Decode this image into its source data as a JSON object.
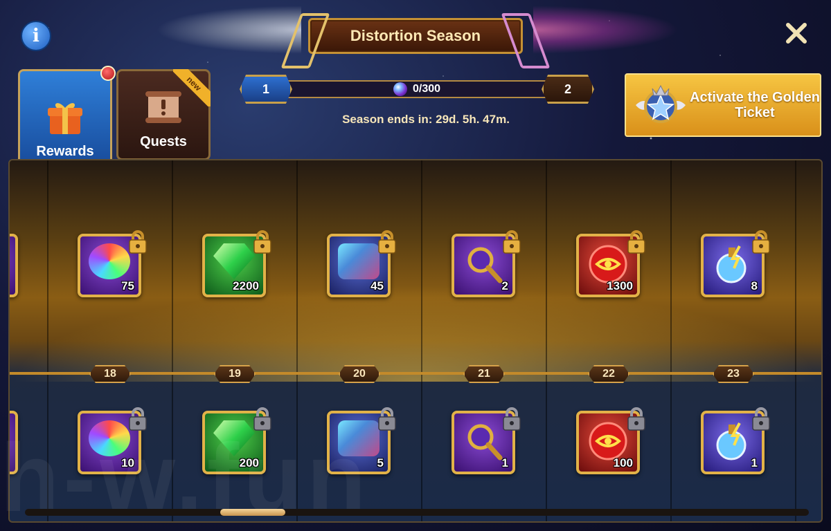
{
  "header": {
    "title": "Distortion Season",
    "info_icon": "info-icon",
    "close_icon": "close-icon"
  },
  "tabs": [
    {
      "label": "Rewards",
      "icon": "gift-icon",
      "active": true,
      "has_notification": true
    },
    {
      "label": "Quests",
      "icon": "scroll-icon",
      "active": false,
      "ribbon": "new"
    }
  ],
  "progress": {
    "current_level": "1",
    "next_level": "2",
    "points": "0/300",
    "fraction": 0.0,
    "season_ends": "Season ends in: 29d. 5h. 47m."
  },
  "golden_ticket": {
    "label": "Activate the Golden Ticket",
    "icon": "golden-ticket-emblem-icon"
  },
  "track": {
    "levels": [
      {
        "level": "18",
        "golden": {
          "icon": "rainbow-orb-icon",
          "qty": "75",
          "locked": true
        },
        "free": {
          "icon": "rainbow-orb-icon",
          "qty": "10",
          "locked": true
        }
      },
      {
        "level": "19",
        "golden": {
          "icon": "emerald-gem-icon",
          "qty": "2200",
          "locked": true
        },
        "free": {
          "icon": "emerald-gem-icon",
          "qty": "200",
          "locked": true
        }
      },
      {
        "level": "20",
        "golden": {
          "icon": "crystal-artifact-icon",
          "qty": "45",
          "locked": true
        },
        "free": {
          "icon": "crystal-artifact-icon",
          "qty": "5",
          "locked": true
        }
      },
      {
        "level": "21",
        "golden": {
          "icon": "magnifier-icon",
          "qty": "2",
          "locked": true
        },
        "free": {
          "icon": "magnifier-icon",
          "qty": "1",
          "locked": true
        }
      },
      {
        "level": "22",
        "golden": {
          "icon": "red-eye-coin-icon",
          "qty": "1300",
          "locked": true
        },
        "free": {
          "icon": "red-eye-coin-icon",
          "qty": "100",
          "locked": true
        }
      },
      {
        "level": "23",
        "golden": {
          "icon": "lightning-potion-icon",
          "qty": "8",
          "locked": true
        },
        "free": {
          "icon": "lightning-potion-icon",
          "qty": "1",
          "locked": true
        }
      }
    ]
  },
  "watermark": "h-w.fun"
}
